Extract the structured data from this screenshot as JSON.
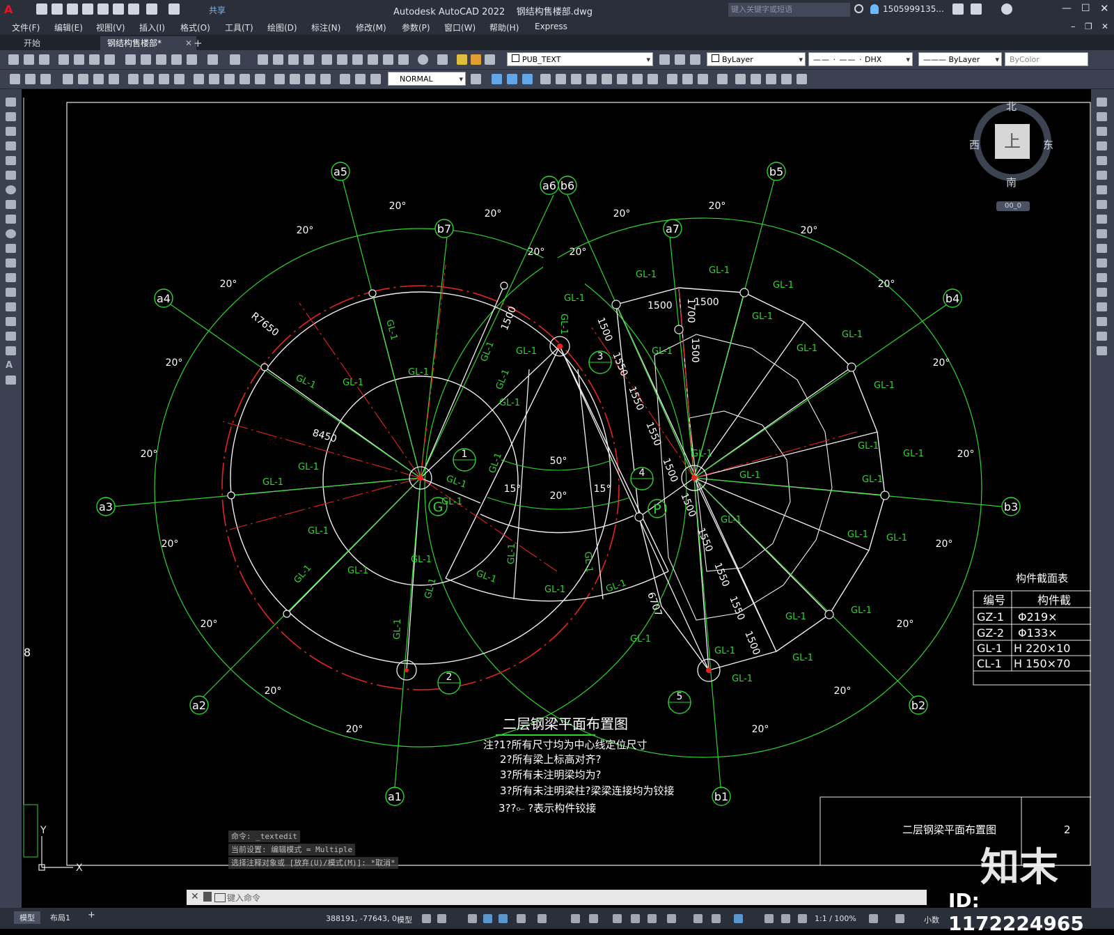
{
  "app": {
    "title": "Autodesk AutoCAD 2022",
    "filename": "钢结构售楼部.dwg",
    "share_label": "共享",
    "search_placeholder": "键入关键字或短语",
    "user": "1505999135..."
  },
  "menu": [
    "文件(F)",
    "编辑(E)",
    "视图(V)",
    "插入(I)",
    "格式(O)",
    "工具(T)",
    "绘图(D)",
    "标注(N)",
    "修改(M)",
    "参数(P)",
    "窗口(W)",
    "帮助(H)",
    "Express"
  ],
  "tabs": {
    "start": "开始",
    "doc": "钢结构售楼部*"
  },
  "toolbar": {
    "layer": "PUB_TEXT",
    "color": "ByLayer",
    "linetype": "DHX",
    "lineweight": "ByLayer",
    "plotstyle": "ByColor",
    "dimstyle": "NORMAL"
  },
  "viewcube": {
    "north": "北",
    "south": "南",
    "east": "东",
    "west": "西",
    "face": "上",
    "wcs": "00_0"
  },
  "drawing": {
    "title": "二层钢梁平面布置图",
    "notes": [
      "注?1?所有尺寸均为中心线定位尺寸",
      "2?所有梁上标高对齐?",
      "3?所有未注明梁均为?",
      "3?所有未注明梁柱?梁梁连接均为铰接",
      "3??⟜ ?表示构件铰接"
    ],
    "axes": [
      "a1",
      "a2",
      "a3",
      "a4",
      "a5",
      "a6",
      "a7",
      "b1",
      "b2",
      "b3",
      "b4",
      "b5",
      "b6",
      "b7"
    ],
    "node_markers": [
      "1",
      "2",
      "3",
      "4",
      "5"
    ],
    "letter_markers": [
      "G",
      "P"
    ],
    "angle_label": "20°",
    "angles_small": [
      "15°",
      "15°",
      "50°",
      "20°"
    ],
    "dims": [
      "R7650",
      "8450",
      "1500",
      "1500",
      "1500",
      "1700",
      "1500",
      "1550",
      "1550",
      "1550",
      "1500",
      "1500",
      "1550",
      "1550",
      "1550",
      "1500",
      "6707"
    ],
    "beam_label": "GL-1",
    "column_label": "GZ-1",
    "section_table": {
      "title": "构件截面表",
      "headers": [
        "编号",
        "构件截"
      ],
      "rows": [
        [
          "GZ-1",
          "Φ219×"
        ],
        [
          "GZ-2",
          "Φ133×"
        ],
        [
          "GL-1",
          "H 220×10"
        ],
        [
          "CL-1",
          "H 150×70"
        ]
      ]
    },
    "title_block": "二层钢梁平面布置图",
    "title_block_num": "2",
    "left_frame_label": "8"
  },
  "command": {
    "history": [
      "命令: _textedit",
      "当前设置: 编辑模式 = Multiple",
      "选择注释对象或 [放弃(U)/模式(M)]: *取消*"
    ],
    "placeholder": "键入命令"
  },
  "status": {
    "layout_tabs": [
      "模型",
      "布局1"
    ],
    "coords": "388191, -77643, 0",
    "mode": "模型",
    "scale": "1:1 / 100%",
    "units": "小数"
  },
  "watermark": {
    "brand": "知末",
    "id": "ID: 1172224965"
  }
}
